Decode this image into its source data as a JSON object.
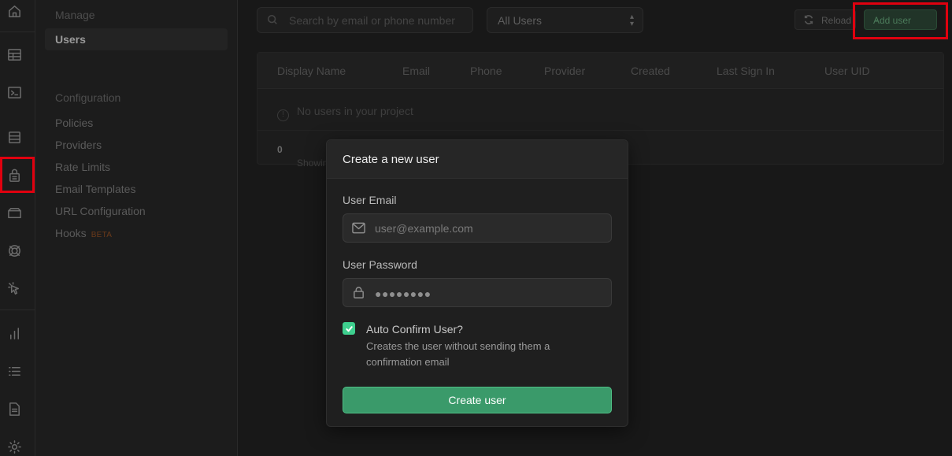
{
  "app": {
    "accent": "#3ecf8e",
    "highlight": "#e0000f"
  },
  "rail": {
    "icons": [
      "home-icon",
      "table-editor-icon",
      "sql-editor-icon",
      "database-icon",
      "auth-icon",
      "storage-icon",
      "realtime-icon",
      "edge-functions-icon",
      "reports-icon",
      "logs-icon",
      "docs-icon",
      "settings-icon"
    ]
  },
  "menu": {
    "manage_heading": "Manage",
    "users": "Users",
    "configuration_heading": "Configuration",
    "items": [
      "Policies",
      "Providers",
      "Rate Limits",
      "Email Templates",
      "URL Configuration",
      "Hooks"
    ],
    "hooks_badge": "BETA"
  },
  "toolbar": {
    "search_placeholder": "Search by email or phone number",
    "filter_value": "All Users",
    "reload_label": "Reload",
    "add_user_label": "Add user"
  },
  "table": {
    "columns": [
      "Display Name",
      "Email",
      "Phone",
      "Provider",
      "Created",
      "Last Sign In",
      "User UID"
    ],
    "empty_message": "No users in your project",
    "footer_prefix": "Showing",
    "footer_count": "0"
  },
  "modal": {
    "title": "Create a new user",
    "email_label": "User Email",
    "email_placeholder": "user@example.com",
    "password_label": "User Password",
    "password_mask": "●●●●●●●●",
    "auto_confirm_label": "Auto Confirm User?",
    "auto_confirm_checked": true,
    "auto_confirm_desc": "Creates the user without sending them a confirmation email",
    "submit_label": "Create user"
  }
}
